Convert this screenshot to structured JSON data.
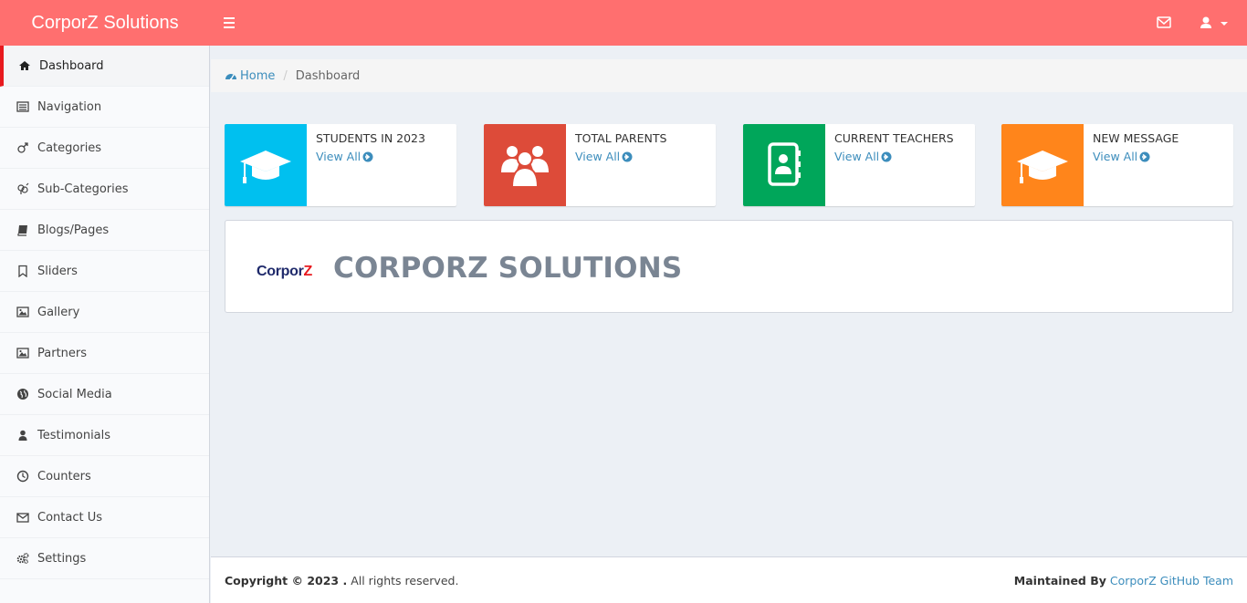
{
  "header": {
    "brand": "CorporZ Solutions",
    "bg_color": "#ff6f6f"
  },
  "sidebar": {
    "items": [
      {
        "label": "Dashboard",
        "icon": "home-icon",
        "active": true
      },
      {
        "label": "Navigation",
        "icon": "list-icon"
      },
      {
        "label": "Categories",
        "icon": "mars-icon"
      },
      {
        "label": "Sub-Categories",
        "icon": "gender-icon"
      },
      {
        "label": "Blogs/Pages",
        "icon": "book-icon"
      },
      {
        "label": "Sliders",
        "icon": "bookmark-icon"
      },
      {
        "label": "Gallery",
        "icon": "image-icon"
      },
      {
        "label": "Partners",
        "icon": "image-icon"
      },
      {
        "label": "Social Media",
        "icon": "globe-icon"
      },
      {
        "label": "Testimonials",
        "icon": "user-icon"
      },
      {
        "label": "Counters",
        "icon": "clock-icon"
      },
      {
        "label": "Contact Us",
        "icon": "envelope-icon"
      },
      {
        "label": "Settings",
        "icon": "cogs-icon"
      }
    ],
    "active_color": "#e8191e"
  },
  "breadcrumb": {
    "home": "Home",
    "current": "Dashboard"
  },
  "info_boxes": [
    {
      "title": "STUDENTS IN 2023",
      "link": "View All",
      "color": "#00c0ef",
      "icon": "graduation-cap-icon"
    },
    {
      "title": "TOTAL PARENTS",
      "link": "View All",
      "color": "#dd4b39",
      "icon": "users-icon"
    },
    {
      "title": "CURRENT TEACHERS",
      "link": "View All",
      "color": "#00a65a",
      "icon": "address-book-icon"
    },
    {
      "title": "NEW MESSAGE",
      "link": "View All",
      "color": "#ff851b",
      "icon": "graduation-cap-icon"
    }
  ],
  "banner": {
    "logo_main": "Corpor",
    "logo_accent": "Z",
    "title": "CORPORZ SOLUTIONS"
  },
  "footer": {
    "copyright_bold": "Copyright © 2023 .",
    "copyright_rest": " All rights reserved.",
    "maintained_label": "Maintained By",
    "maintained_link": "CorporZ GitHub Team"
  }
}
